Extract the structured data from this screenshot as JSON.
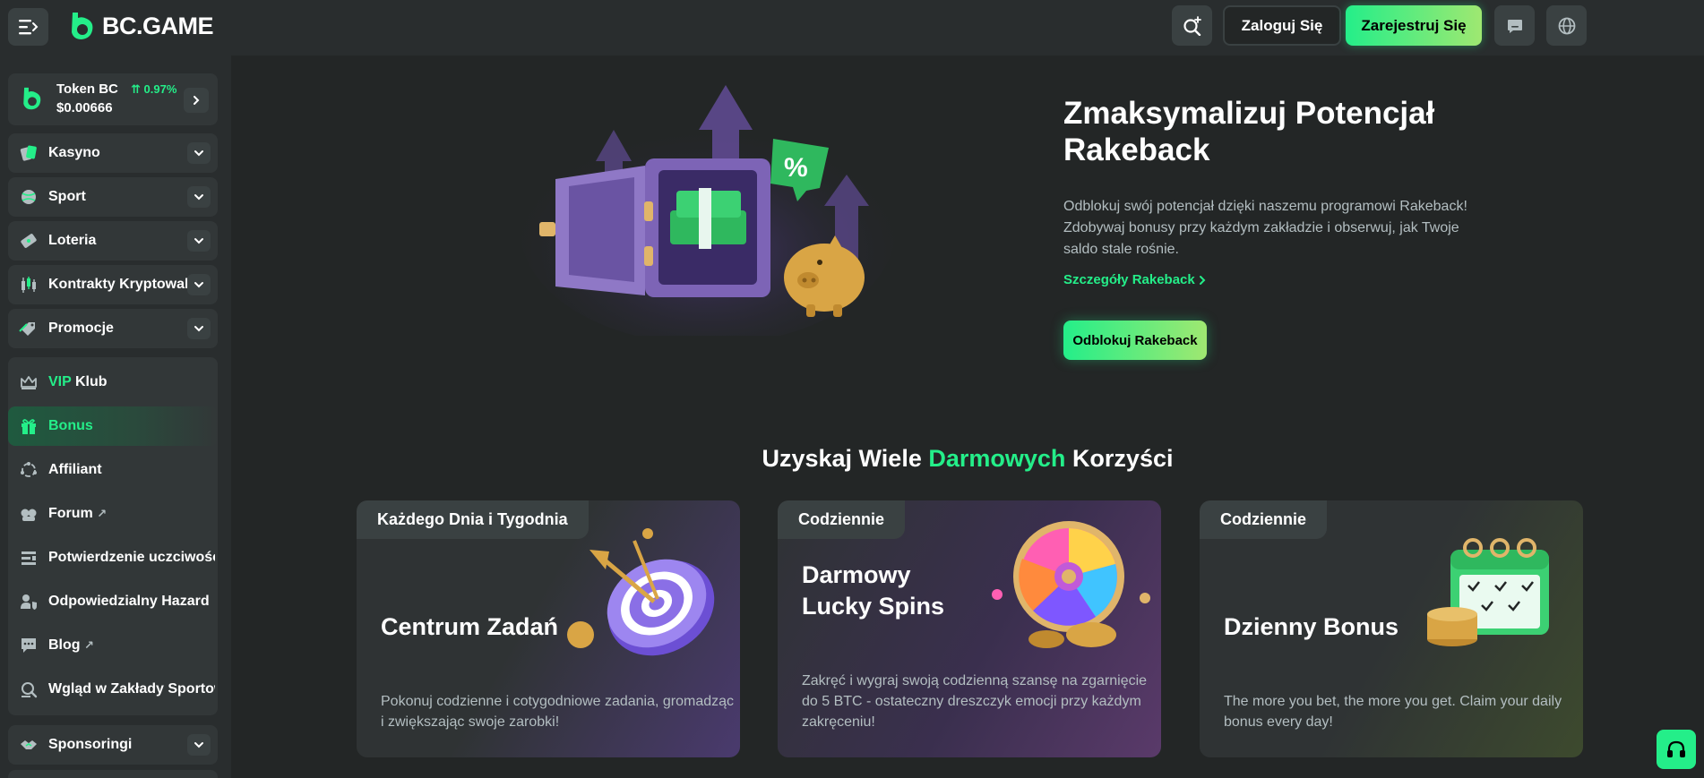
{
  "header": {
    "logo_text": "BC.GAME",
    "login_label": "Zaloguj Się",
    "register_label": "Zarejestruj Się"
  },
  "sidebar": {
    "token": {
      "name": "Token BC",
      "change": "0.97%",
      "price": "$0.00666"
    },
    "nav": [
      {
        "label": "Kasyno",
        "icon": "cards-icon"
      },
      {
        "label": "Sport",
        "icon": "basketball-icon"
      },
      {
        "label": "Loteria",
        "icon": "ticket-icon"
      },
      {
        "label": "Kontrakty Kryptowalu",
        "icon": "candles-icon"
      },
      {
        "label": "Promocje",
        "icon": "tag-icon"
      }
    ],
    "group": {
      "vip_prefix": "VIP",
      "vip_suffix": "Klub",
      "items": [
        {
          "label": "Bonus",
          "icon": "gift-icon"
        },
        {
          "label": "Affiliant",
          "icon": "network-icon"
        },
        {
          "label": "Forum",
          "icon": "forum-icon"
        },
        {
          "label": "Potwierdzenie uczciwości",
          "icon": "scales-icon"
        },
        {
          "label": "Odpowiedzialny Hazard",
          "icon": "user-shield-icon"
        },
        {
          "label": "Blog",
          "icon": "chat-icon"
        },
        {
          "label": "Wgląd w Zakłady Sportowe",
          "icon": "insight-icon"
        }
      ]
    },
    "sponsoring_label": "Sponsoringi"
  },
  "hero": {
    "title": "Zmaksymalizuj Potencjał Rakeback",
    "description": "Odblokuj swój potencjał dzięki naszemu programowi Rakeback! Zdobywaj bonusy przy każdym zakładzie i obserwuj, jak Twoje saldo stale rośnie.",
    "link_label": "Szczegóły Rakeback",
    "button_label": "Odblokuj Rakeback"
  },
  "benefits": {
    "title_part1": "Uzyskaj Wiele",
    "title_highlight": "Darmowych",
    "title_part2": "Korzyści",
    "cards": [
      {
        "tag": "Każdego Dnia i Tygodnia",
        "title": "Centrum Zadań",
        "description": "Pokonuj codzienne i cotygodniowe zadania, gromadząc i zwiększając swoje zarobki!"
      },
      {
        "tag": "Codziennie",
        "title": "Darmowy Lucky Spins",
        "description": "Zakręć i wygraj swoją codzienną szansę na zgarnięcie do 5 BTC - ostateczny dreszczyk emocji przy każdym zakręceniu!"
      },
      {
        "tag": "Codziennie",
        "title": "Dzienny Bonus",
        "description": "The more you bet, the more you get. Claim your daily bonus every day!"
      }
    ]
  },
  "colors": {
    "accent": "#24ee89",
    "background": "#232626",
    "panel": "#292d2e",
    "muted_text": "#b3bec1"
  }
}
